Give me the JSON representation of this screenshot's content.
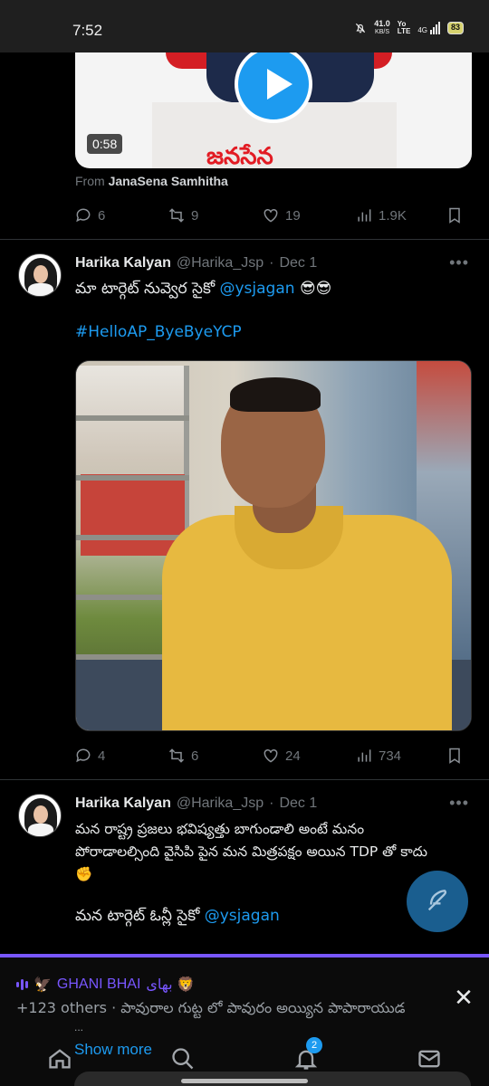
{
  "status_bar": {
    "time": "7:52",
    "net_speed_value": "41.0",
    "net_speed_unit": "KB/S",
    "volte_top": "Yo",
    "volte_bottom": "LTE",
    "signal_label": "4G",
    "battery": "83"
  },
  "tweet_top": {
    "video_duration": "0:58",
    "podium_text": "జనసేన",
    "from_prefix": "From",
    "from_name": "JanaSena Samhitha",
    "replies": "6",
    "retweets": "9",
    "likes": "19",
    "views": "1.9K"
  },
  "tweet_2": {
    "name": "Harika Kalyan",
    "handle": "@Harika_Jsp",
    "separator": "·",
    "date": "Dec 1",
    "text_before": "మా టార్గెట్ నువ్వెర సైకో",
    "mention": "@ysjagan",
    "emoji": "😎😎",
    "hashtag": "#HelloAP_ByeByeYCP",
    "replies": "4",
    "retweets": "6",
    "likes": "24",
    "views": "734"
  },
  "tweet_3": {
    "name": "Harika Kalyan",
    "handle": "@Harika_Jsp",
    "separator": "·",
    "date": "Dec 1",
    "line1": "మన రాష్ట్ర ప్రజలు భవిష్యత్తు బాగుండాలి అంటే మనం",
    "line2": "పోరాడాలల్సింది వైసిపి పైన మన మిత్రపక్షం అయిన TDP తో కాదు",
    "line3_emoji": "✊",
    "line4_before": "మన టార్గెట్ ఓన్లీ సైకో",
    "mention": "@ysjagan"
  },
  "space_bar": {
    "host_prefix": "🦅",
    "host_name": "GHANI BHAI",
    "host_suffix": "بھای 🦁",
    "listeners": "+123 others",
    "bullet": "·",
    "title": "పావురాల గుట్ట లో పావురం అయ్యిన పాపారాయుడ",
    "ellipsis": "...",
    "show_more": "Show more",
    "close_symbol": "✕",
    "accent": "#7856ff"
  },
  "bottom_nav": {
    "notifications_badge": "2"
  },
  "colors": {
    "link": "#1d9bf0",
    "background": "#000000",
    "muted": "#71767b"
  }
}
